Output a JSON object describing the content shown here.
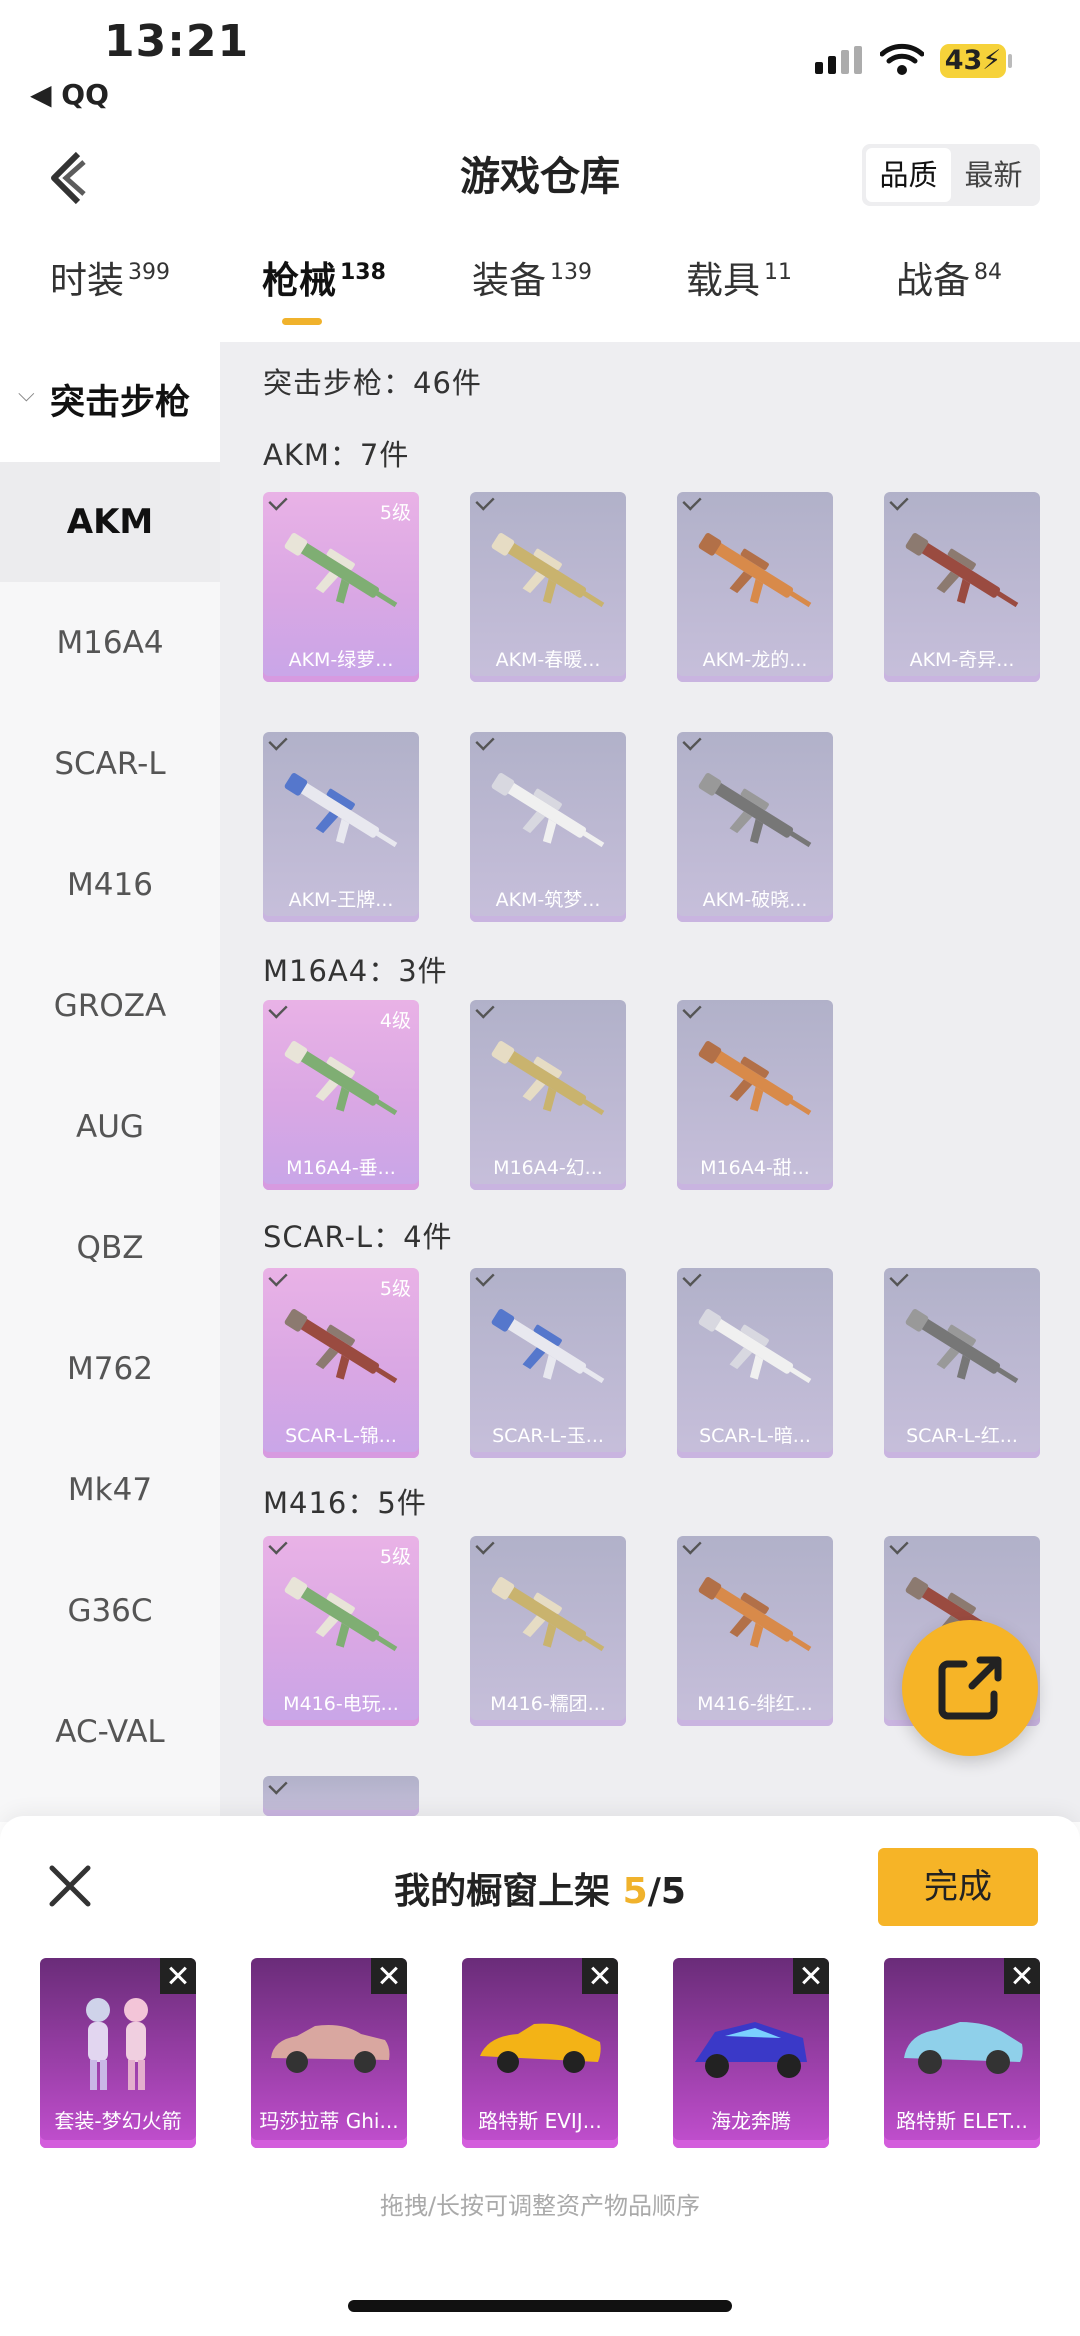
{
  "status_bar": {
    "time": "13:21",
    "back_app": "◀ QQ",
    "battery": "43"
  },
  "header": {
    "title": "游戏仓库",
    "sort_options": [
      "品质",
      "最新"
    ],
    "sort_selected": "品质"
  },
  "tabs": [
    {
      "label": "时装",
      "count": "399"
    },
    {
      "label": "枪械",
      "count": "138",
      "active": true
    },
    {
      "label": "装备",
      "count": "139"
    },
    {
      "label": "载具",
      "count": "11"
    },
    {
      "label": "战备",
      "count": "84"
    }
  ],
  "sidebar": {
    "category": "突击步枪",
    "items": [
      "AKM",
      "M16A4",
      "SCAR-L",
      "M416",
      "GROZA",
      "AUG",
      "QBZ",
      "M762",
      "Mk47",
      "G36C",
      "AC-VAL"
    ],
    "active": "AKM"
  },
  "main": {
    "category_summary": "突击步枪：46件",
    "sections": [
      {
        "title": "AKM：7件",
        "items": [
          {
            "name": "AKM-绿萝...",
            "level": "5级"
          },
          {
            "name": "AKM-春暖..."
          },
          {
            "name": "AKM-龙的..."
          },
          {
            "name": "AKM-奇异..."
          },
          {
            "name": "AKM-王牌..."
          },
          {
            "name": "AKM-筑梦..."
          },
          {
            "name": "AKM-破晓..."
          }
        ]
      },
      {
        "title": "M16A4：3件",
        "items": [
          {
            "name": "M16A4-垂...",
            "level": "4级"
          },
          {
            "name": "M16A4-幻..."
          },
          {
            "name": "M16A4-甜..."
          }
        ]
      },
      {
        "title": "SCAR-L：4件",
        "items": [
          {
            "name": "SCAR-L-锦...",
            "level": "5级"
          },
          {
            "name": "SCAR-L-玉..."
          },
          {
            "name": "SCAR-L-暗..."
          },
          {
            "name": "SCAR-L-红..."
          }
        ]
      },
      {
        "title": "M416：5件",
        "items": [
          {
            "name": "M416-电玩...",
            "level": "5级"
          },
          {
            "name": "M416-糯团..."
          },
          {
            "name": "M416-绯红..."
          },
          {
            "name": ""
          }
        ]
      }
    ]
  },
  "showcase": {
    "title": "我的橱窗上架",
    "count": "5",
    "total": "/5",
    "done_label": "完成",
    "items": [
      "套装-梦幻火箭",
      "玛莎拉蒂 Ghi...",
      "路特斯 EVIJ...",
      "海龙奔腾",
      "路特斯 ELET..."
    ],
    "hint": "拖拽/长按可调整资产物品顺序"
  },
  "colors": {
    "accent": "#f6b427",
    "card_top": "#e3aee6",
    "card_normal": "#b8b6cf",
    "showcase_card": "#9a3cab"
  }
}
